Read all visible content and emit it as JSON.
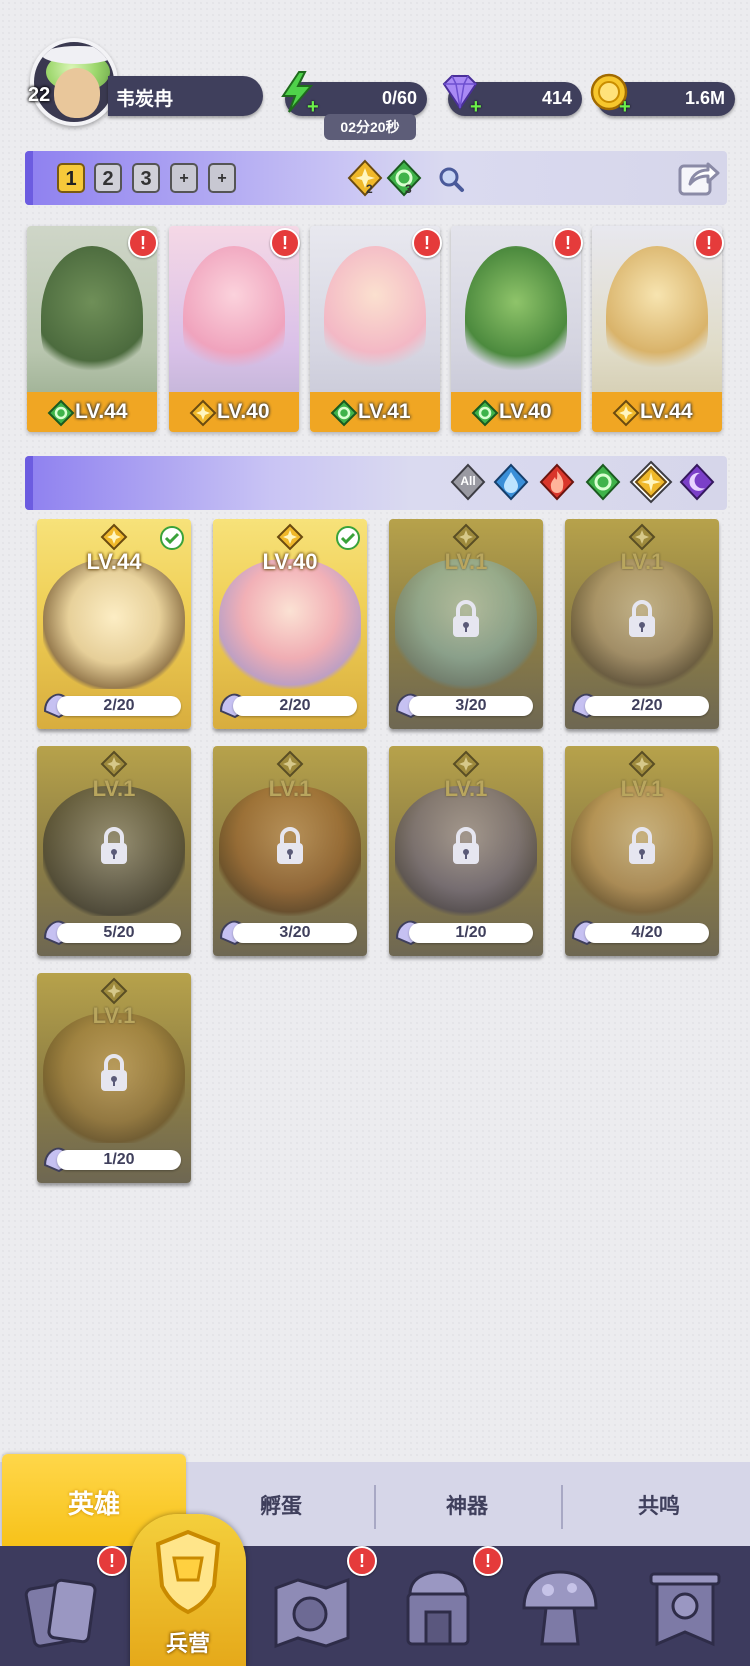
{
  "player": {
    "level": "22",
    "name": "韦炭冉"
  },
  "resources": {
    "energy": {
      "value": "0/60",
      "icon": "lightning-icon"
    },
    "energy_timer": "02分20秒",
    "gems": {
      "value": "414",
      "icon": "gem-icon"
    },
    "gold": {
      "value": "1.6M",
      "icon": "gold-coin-icon"
    }
  },
  "team_tabs": [
    "1",
    "2",
    "3",
    "+",
    "+"
  ],
  "team_elements": [
    {
      "icon": "light-element-icon",
      "count": "2"
    },
    {
      "icon": "wind-element-icon",
      "count": "3"
    }
  ],
  "team": [
    {
      "level": "LV.44",
      "element": "wind",
      "alert": "!"
    },
    {
      "level": "LV.40",
      "element": "light",
      "alert": "!"
    },
    {
      "level": "LV.41",
      "element": "wind",
      "alert": "!"
    },
    {
      "level": "LV.40",
      "element": "wind",
      "alert": "!"
    },
    {
      "level": "LV.44",
      "element": "light",
      "alert": "!"
    }
  ],
  "filters": [
    "All",
    "water",
    "fire",
    "wind",
    "light",
    "dark"
  ],
  "heroes": [
    {
      "level": "LV.44",
      "progress": "2/20",
      "locked": false
    },
    {
      "level": "LV.40",
      "progress": "2/20",
      "locked": false
    },
    {
      "level": "LV.1",
      "progress": "3/20",
      "locked": true
    },
    {
      "level": "LV.1",
      "progress": "2/20",
      "locked": true
    },
    {
      "level": "LV.1",
      "progress": "5/20",
      "locked": true
    },
    {
      "level": "LV.1",
      "progress": "3/20",
      "locked": true
    },
    {
      "level": "LV.1",
      "progress": "1/20",
      "locked": true
    },
    {
      "level": "LV.1",
      "progress": "4/20",
      "locked": true
    },
    {
      "level": "LV.1",
      "progress": "1/20",
      "locked": true
    }
  ],
  "tabs": {
    "heroes": "英雄",
    "hatch": "孵蛋",
    "artifact": "神器",
    "resonance": "共鸣"
  },
  "nav": {
    "barracks": "兵营",
    "alert": "!"
  },
  "colors": {
    "accent": "#f7c21a",
    "panel": "#3f3f5c",
    "alert": "#e53b3b",
    "bar": "#8e80f0"
  }
}
